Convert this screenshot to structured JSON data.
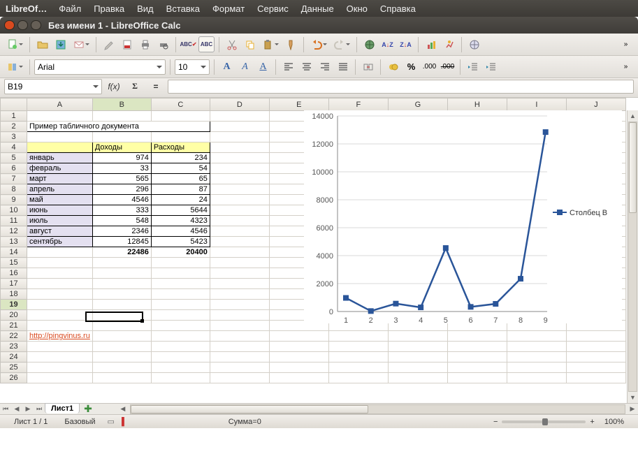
{
  "app_name": "LibreOf…",
  "menu": [
    "Файл",
    "Правка",
    "Вид",
    "Вставка",
    "Формат",
    "Сервис",
    "Данные",
    "Окно",
    "Справка"
  ],
  "window_title": "Без имени 1 - LibreOffice Calc",
  "font_name": "Arial",
  "font_size": "10",
  "cell_ref": "B19",
  "sheet": {
    "columns": [
      "A",
      "B",
      "C",
      "D",
      "E",
      "F",
      "G",
      "H",
      "I",
      "J"
    ],
    "title_cell": "Пример табличного документа",
    "headers": [
      "",
      "Доходы",
      "Расходы"
    ],
    "rows": [
      {
        "month": "январь",
        "income": 974,
        "expense": 234
      },
      {
        "month": "февраль",
        "income": 33,
        "expense": 54
      },
      {
        "month": "март",
        "income": 565,
        "expense": 65
      },
      {
        "month": "апрель",
        "income": 296,
        "expense": 87
      },
      {
        "month": "май",
        "income": 4546,
        "expense": 24
      },
      {
        "month": "июнь",
        "income": 333,
        "expense": 5644
      },
      {
        "month": "июль",
        "income": 548,
        "expense": 4323
      },
      {
        "month": "август",
        "income": 2346,
        "expense": 4546
      },
      {
        "month": "сентябрь",
        "income": 12845,
        "expense": 5423
      }
    ],
    "totals": {
      "income": 22486,
      "expense": 20400
    },
    "link_text": "http://pingvinus.ru"
  },
  "chart_data": {
    "type": "line",
    "x": [
      1,
      2,
      3,
      4,
      5,
      6,
      7,
      8,
      9
    ],
    "series": [
      {
        "name": "Столбец B",
        "values": [
          974,
          33,
          565,
          296,
          4546,
          333,
          548,
          2346,
          12845
        ]
      }
    ],
    "ylim": [
      0,
      14000
    ],
    "yticks": [
      0,
      2000,
      4000,
      6000,
      8000,
      10000,
      12000,
      14000
    ],
    "legend": "Столбец B",
    "color": "#2a5599"
  },
  "tabs": {
    "active": "Лист1"
  },
  "status": {
    "sheet": "Лист 1 / 1",
    "style": "Базовый",
    "sum": "Сумма=0",
    "zoom": "100%",
    "zoom_minus": "−",
    "zoom_plus": "+"
  }
}
